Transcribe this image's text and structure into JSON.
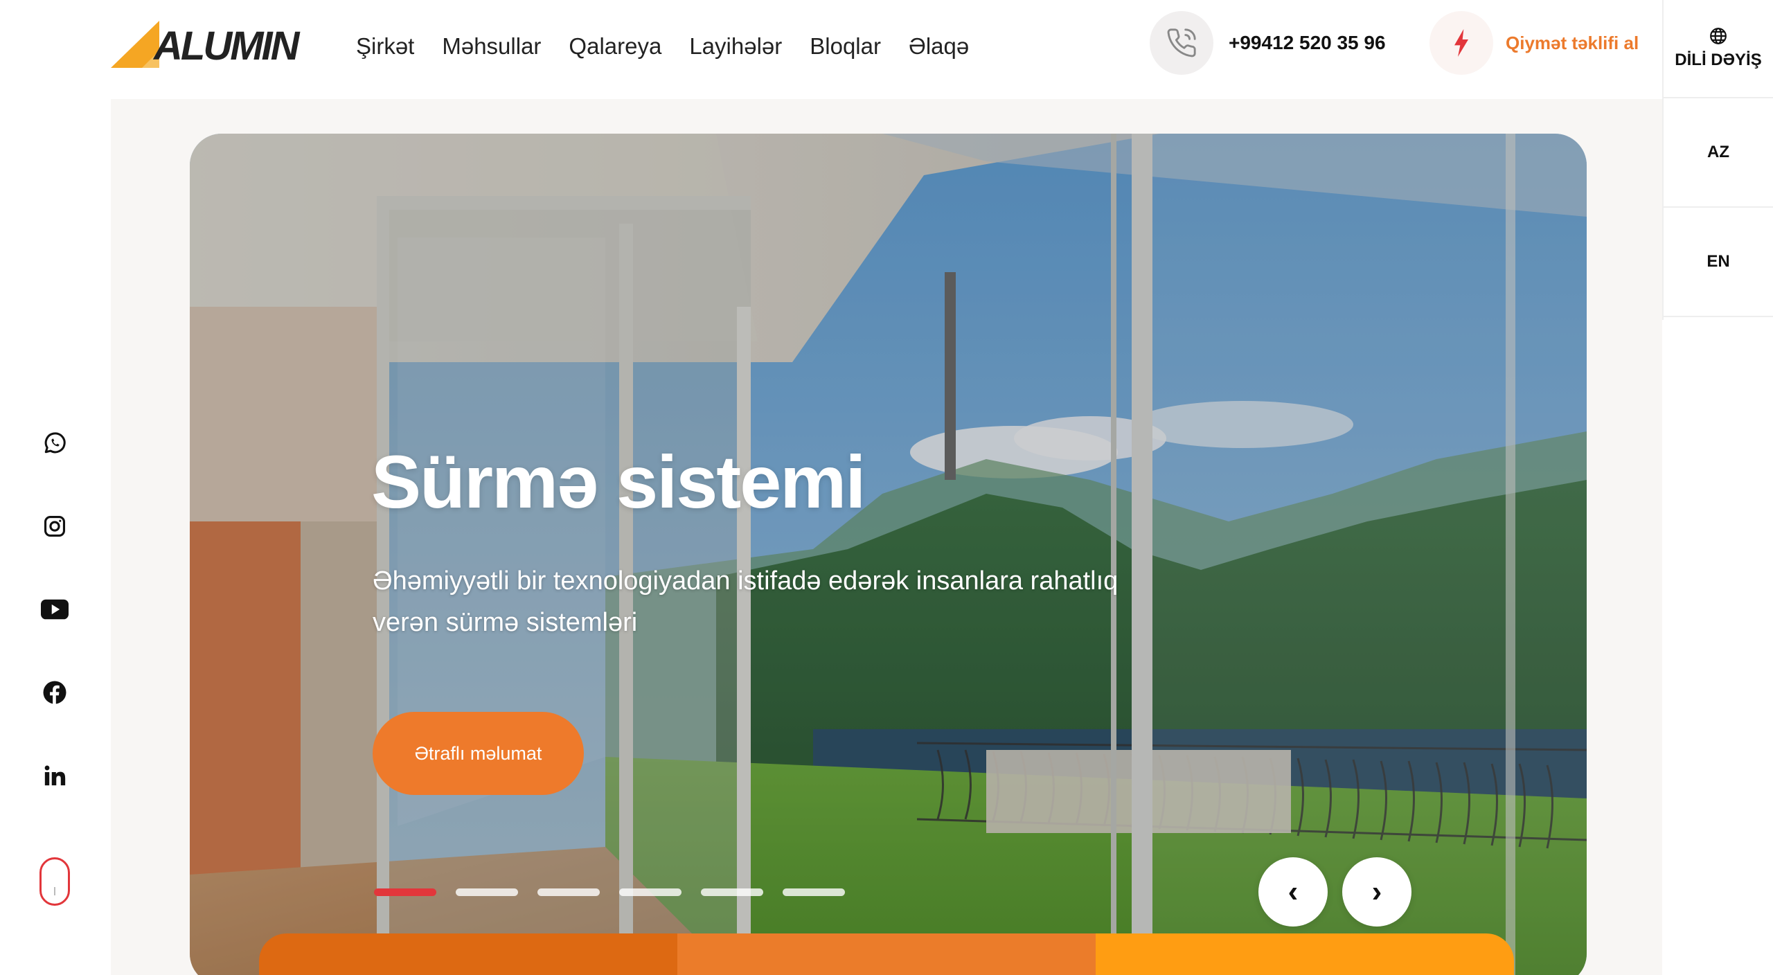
{
  "header": {
    "logo_text": "ALUMIN",
    "nav": [
      "Şirkət",
      "Məhsullar",
      "Qalareya",
      "Layihələr",
      "Bloqlar",
      "Əlaqə"
    ],
    "phone": "+99412 520 35 96",
    "quote_label": "Qiymət təklifi al"
  },
  "language": {
    "title": "DİLİ DƏYİŞ",
    "options": [
      "AZ",
      "EN"
    ]
  },
  "social": [
    "whatsapp-icon",
    "instagram-icon",
    "youtube-icon",
    "facebook-icon",
    "linkedin-icon"
  ],
  "hero": {
    "title": "Sürmə sistemi",
    "description": "Əhəmiyyətli bir texnologiyadan istifadə edərək insanlara rahatlıq verən sürmə sistemləri",
    "button": "Ətraflı məlumat",
    "slides_count": 6,
    "active_slide": 1,
    "prev": "‹",
    "next": "›"
  },
  "colors": {
    "accent": "#ee7a2b",
    "active_dot": "#e2363b",
    "logo_orange": "#f5a623",
    "bottom_bar": [
      "#dd6912",
      "#eb7c2a",
      "#ff9d12"
    ]
  }
}
